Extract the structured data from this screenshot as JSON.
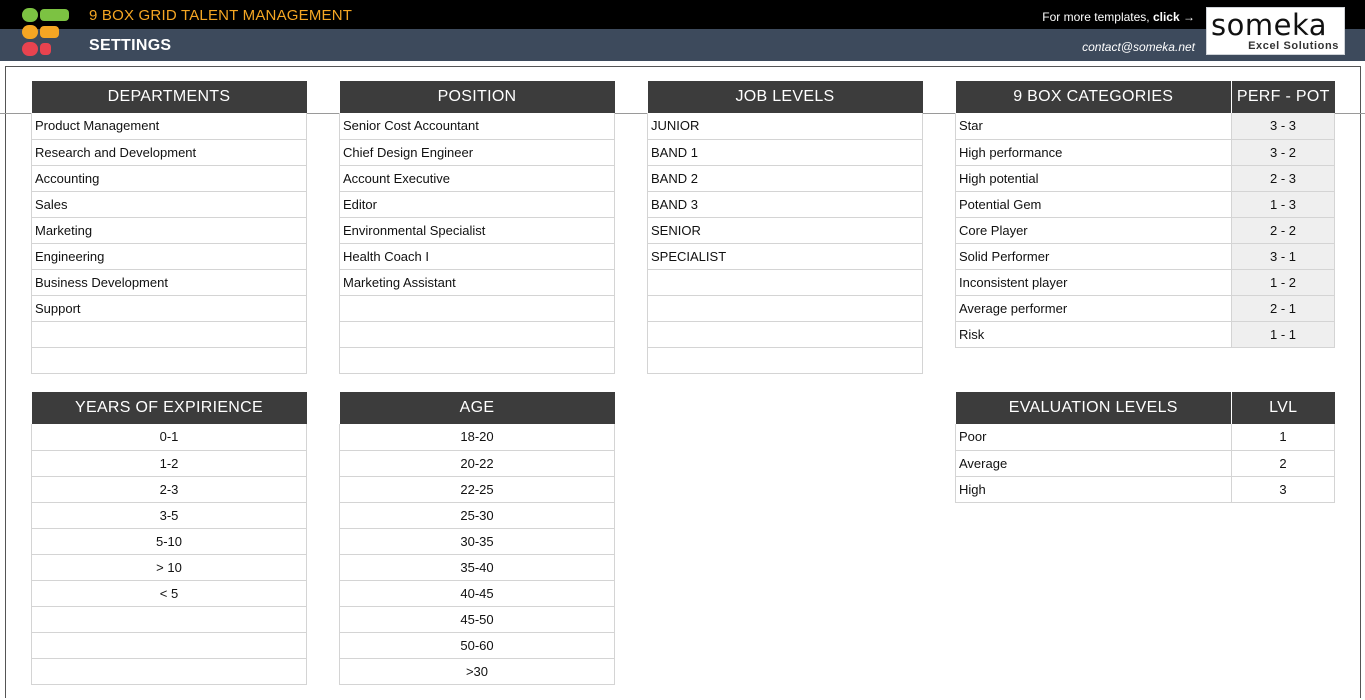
{
  "header": {
    "app_title": "9 BOX GRID TALENT MANAGEMENT",
    "page_title": "SETTINGS",
    "templates_text": "For more templates, ",
    "templates_link": "click →",
    "contact": "contact@someka.net",
    "brand_name": "someka",
    "brand_sub": "Excel Solutions",
    "logo_colors": [
      "#7cc242",
      "#f5a623",
      "#e8434f"
    ]
  },
  "departments": {
    "header": "DEPARTMENTS",
    "rows": [
      "Product Management",
      "Research and Development",
      "Accounting",
      "Sales",
      "Marketing",
      "Engineering",
      "Business Development",
      "Support",
      "",
      ""
    ]
  },
  "position": {
    "header": "POSITION",
    "rows": [
      "Senior Cost Accountant",
      "Chief Design Engineer",
      "Account Executive",
      "Editor",
      "Environmental Specialist",
      "Health Coach I",
      "Marketing Assistant",
      "",
      "",
      ""
    ]
  },
  "job_levels": {
    "header": "JOB LEVELS",
    "rows": [
      "JUNIOR",
      "BAND 1",
      "BAND 2",
      "BAND 3",
      "SENIOR",
      "SPECIALIST",
      "",
      "",
      "",
      ""
    ]
  },
  "categories": {
    "header_name": "9 BOX CATEGORIES",
    "header_code": "PERF - POT",
    "rows": [
      {
        "name": "Star",
        "code": "3 - 3"
      },
      {
        "name": "High performance",
        "code": "3 - 2"
      },
      {
        "name": "High potential",
        "code": "2 - 3"
      },
      {
        "name": "Potential Gem",
        "code": "1 - 3"
      },
      {
        "name": "Core Player",
        "code": "2 - 2"
      },
      {
        "name": "Solid Performer",
        "code": "3 - 1"
      },
      {
        "name": "Inconsistent player",
        "code": "1 - 2"
      },
      {
        "name": "Average performer",
        "code": "2 - 1"
      },
      {
        "name": "Risk",
        "code": "1 - 1"
      }
    ]
  },
  "experience": {
    "header": "YEARS OF EXPIRIENCE",
    "rows": [
      "0-1",
      "1-2",
      "2-3",
      "3-5",
      "5-10",
      "> 10",
      "< 5",
      "",
      "",
      ""
    ]
  },
  "age": {
    "header": "AGE",
    "rows": [
      "18-20",
      "20-22",
      "22-25",
      "25-30",
      "30-35",
      "35-40",
      "40-45",
      "45-50",
      "50-60",
      ">30"
    ]
  },
  "evaluation": {
    "header_name": "EVALUATION LEVELS",
    "header_lvl": "LVL",
    "rows": [
      {
        "name": "Poor",
        "lvl": "1"
      },
      {
        "name": "Average",
        "lvl": "2"
      },
      {
        "name": "High",
        "lvl": "3"
      }
    ]
  }
}
